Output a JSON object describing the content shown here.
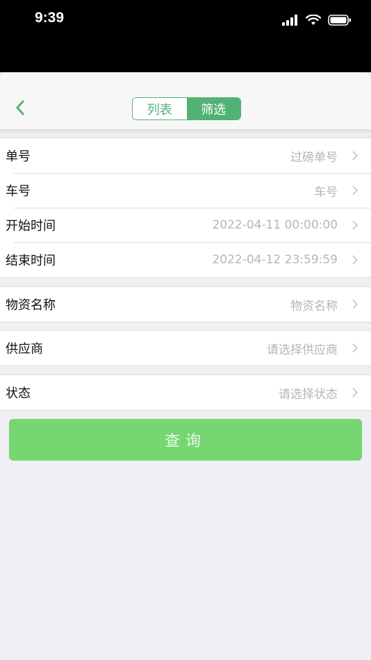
{
  "status_bar": {
    "time": "9:39"
  },
  "nav": {
    "back_icon": "chevron-left-icon",
    "tabs": [
      {
        "label": "列表",
        "active": false
      },
      {
        "label": "筛选",
        "active": true
      }
    ]
  },
  "groups": [
    {
      "rows": [
        {
          "label": "单号",
          "value": "过磅单号"
        },
        {
          "label": "车号",
          "value": "车号"
        },
        {
          "label": "开始时间",
          "value": "2022-04-11 00:00:00"
        },
        {
          "label": "结束时间",
          "value": "2022-04-12 23:59:59"
        }
      ]
    },
    {
      "rows": [
        {
          "label": "物资名称",
          "value": "物资名称"
        }
      ]
    },
    {
      "rows": [
        {
          "label": "供应商",
          "value": "请选择供应商"
        }
      ]
    },
    {
      "rows": [
        {
          "label": "状态",
          "value": "请选择状态"
        }
      ]
    }
  ],
  "query_button": {
    "label": "查询"
  },
  "colors": {
    "accent": "#52b275",
    "button": "#76d672",
    "background": "#efeff4"
  }
}
